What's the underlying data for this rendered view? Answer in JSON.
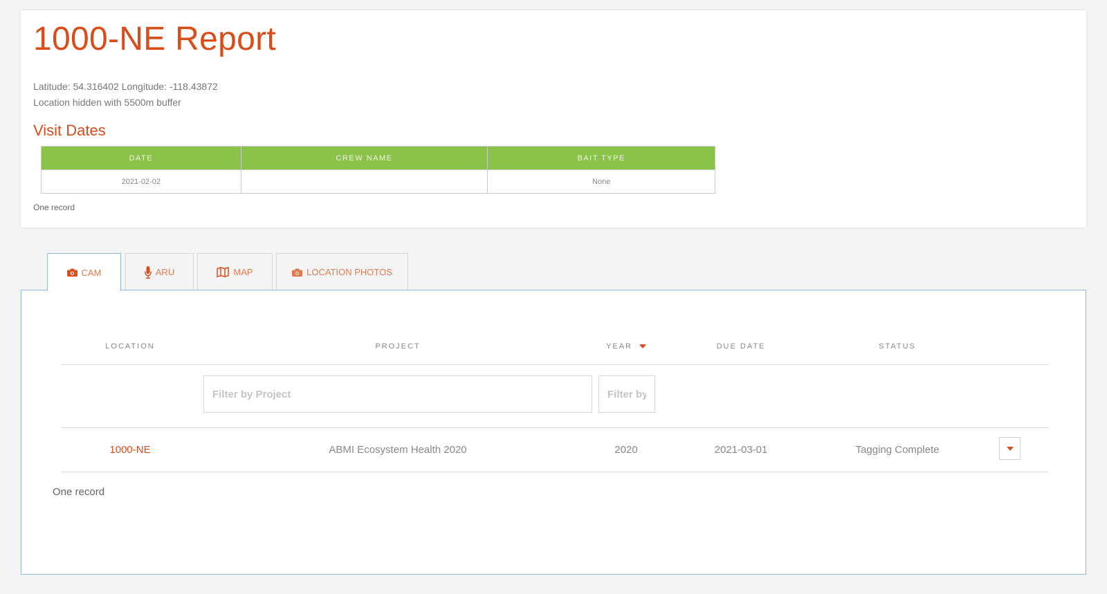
{
  "report": {
    "title": "1000-NE Report",
    "latitude_label": "Latitude:",
    "latitude": "54.316402",
    "longitude_label": "Longitude:",
    "longitude": "-118.43872",
    "buffer_note": "Location hidden with 5500m buffer"
  },
  "visits": {
    "section_title": "Visit Dates",
    "columns": [
      "DATE",
      "CREW NAME",
      "BAIT TYPE"
    ],
    "rows": [
      {
        "date": "2021-02-02",
        "crew": "",
        "bait": "None"
      }
    ],
    "record_count": "One record"
  },
  "tabs": [
    {
      "label": "CAM",
      "icon": "camera-icon",
      "active": true
    },
    {
      "label": "ARU",
      "icon": "microphone-icon",
      "active": false
    },
    {
      "label": "MAP",
      "icon": "map-icon",
      "active": false
    },
    {
      "label": "LOCATION PHOTOS",
      "icon": "camera-icon",
      "active": false
    }
  ],
  "grid": {
    "columns": {
      "location": "LOCATION",
      "project": "PROJECT",
      "year": "YEAR",
      "due_date": "DUE DATE",
      "status": "STATUS"
    },
    "filters": {
      "project_placeholder": "Filter by Project",
      "year_placeholder": "Filter by Year"
    },
    "rows": [
      {
        "location": "1000-NE",
        "project": "ABMI Ecosystem Health 2020",
        "year": "2020",
        "due_date": "2021-03-01",
        "status": "Tagging Complete"
      }
    ],
    "record_count": "One record"
  },
  "colors": {
    "accent": "#d94d1a",
    "header_green": "#8bc34a",
    "panel_border": "#8fb9e4"
  }
}
